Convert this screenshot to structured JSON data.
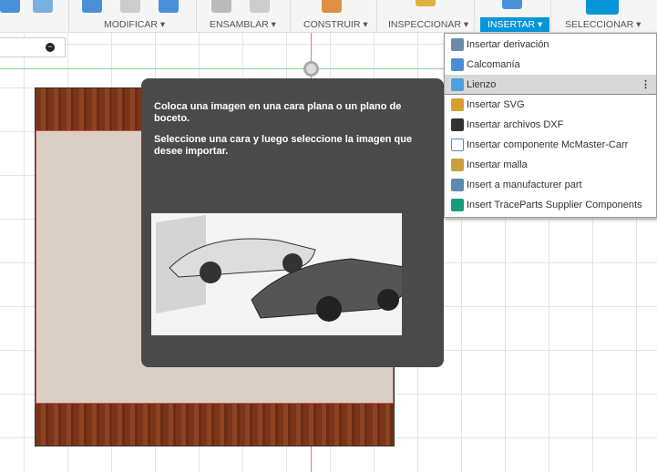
{
  "toolbar": {
    "groups": [
      {
        "label": "MODIFICAR ▾"
      },
      {
        "label": "ENSAMBLAR ▾"
      },
      {
        "label": "CONSTRUIR ▾"
      },
      {
        "label": "INSPECCIONAR ▾"
      },
      {
        "label": "INSERTAR ▾",
        "active": true
      },
      {
        "label": "SELECCIONAR ▾"
      }
    ],
    "accent": "#0696d7"
  },
  "browser": {
    "collapse_icon": "minus-circle-icon"
  },
  "tooltip": {
    "line1": "Coloca una imagen en una cara plana o un plano de boceto.",
    "line2": "Seleccione una cara y luego seleccione la imagen que desee importar."
  },
  "menu": {
    "items": [
      {
        "label": "Insertar derivación",
        "icon": "derive-icon",
        "color": "#6a8aa8"
      },
      {
        "label": "Calcomanía",
        "icon": "decal-icon",
        "color": "#4a8fd0"
      },
      {
        "label": "Lienzo",
        "icon": "canvas-image-icon",
        "color": "#4aa0e0",
        "selected": true
      },
      {
        "label": "Insertar SVG",
        "icon": "svg-file-icon",
        "color": "#d8a030"
      },
      {
        "label": "Insertar archivos DXF",
        "icon": "dxf-file-icon",
        "color": "#333333"
      },
      {
        "label": "Insertar componente McMaster-Carr",
        "icon": "mcmaster-icon",
        "color": "#4a8fd0"
      },
      {
        "label": "Insertar malla",
        "icon": "mesh-icon",
        "color": "#c8a040"
      },
      {
        "label": "Insert a manufacturer part",
        "icon": "manufacturer-part-icon",
        "color": "#5a8ab0"
      },
      {
        "label": "Insert TraceParts Supplier Components",
        "icon": "traceparts-icon",
        "color": "#1a9a80"
      }
    ]
  }
}
